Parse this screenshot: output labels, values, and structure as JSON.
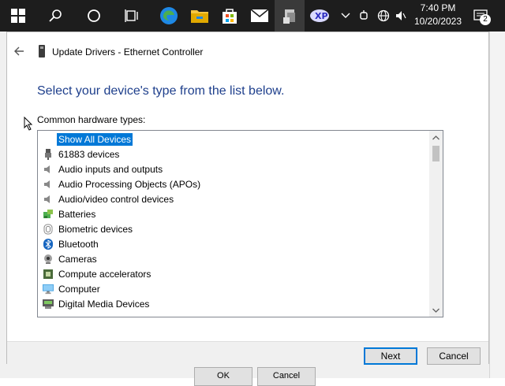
{
  "taskbar": {
    "clock_time": "7:40 PM",
    "clock_date": "10/20/2023",
    "notification_count": "2",
    "pinned": [
      "start-icon",
      "search-icon",
      "cortana-icon",
      "task-view-icon",
      "edge-icon",
      "file-explorer-icon",
      "store-icon",
      "mail-icon",
      "device-manager-icon",
      "app-icon"
    ]
  },
  "dialog": {
    "title": "Update Drivers - Ethernet Controller",
    "heading": "Select your device's type from the list below.",
    "list_label": "Common hardware types:",
    "items": [
      {
        "label": "Show All Devices",
        "icon": "none",
        "selected": true
      },
      {
        "label": "61883 devices",
        "icon": "usb-plug-icon"
      },
      {
        "label": "Audio inputs and outputs",
        "icon": "speaker-icon"
      },
      {
        "label": "Audio Processing Objects (APOs)",
        "icon": "speaker-icon"
      },
      {
        "label": "Audio/video control devices",
        "icon": "speaker-icon"
      },
      {
        "label": "Batteries",
        "icon": "battery-icon"
      },
      {
        "label": "Biometric devices",
        "icon": "fingerprint-icon"
      },
      {
        "label": "Bluetooth",
        "icon": "bluetooth-icon"
      },
      {
        "label": "Cameras",
        "icon": "camera-icon"
      },
      {
        "label": "Compute accelerators",
        "icon": "chip-icon"
      },
      {
        "label": "Computer",
        "icon": "monitor-icon"
      },
      {
        "label": "Digital Media Devices",
        "icon": "media-device-icon"
      }
    ],
    "next_label": "Next",
    "cancel_label": "Cancel"
  },
  "background": {
    "ok_label": "OK",
    "cancel_label": "Cancel"
  }
}
